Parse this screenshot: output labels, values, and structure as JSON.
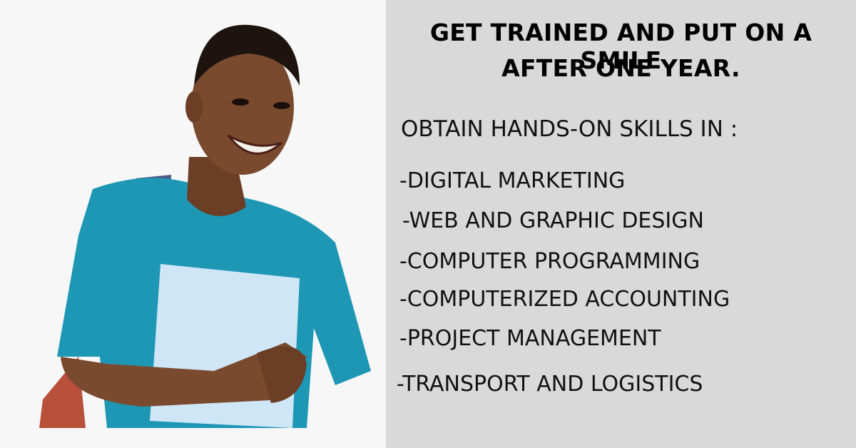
{
  "headline": {
    "line1": "GET TRAINED AND PUT ON A SMILE",
    "line2": "AFTER ONE YEAR."
  },
  "intro": "OBTAIN HANDS-ON SKILLS IN :",
  "skills": [
    "-DIGITAL MARKETING",
    "-WEB AND GRAPHIC DESIGN",
    "-COMPUTER PROGRAMMING",
    "-COMPUTERIZED ACCOUNTING",
    "-PROJECT MANAGEMENT",
    "-TRANSPORT AND LOGISTICS"
  ],
  "colors": {
    "left_bg": "#f7f7f7",
    "panel_bg": "#d9d9d9",
    "shirt": "#1e97b5",
    "skin": "#7a4a2e",
    "folder": "#cfe6f7"
  }
}
